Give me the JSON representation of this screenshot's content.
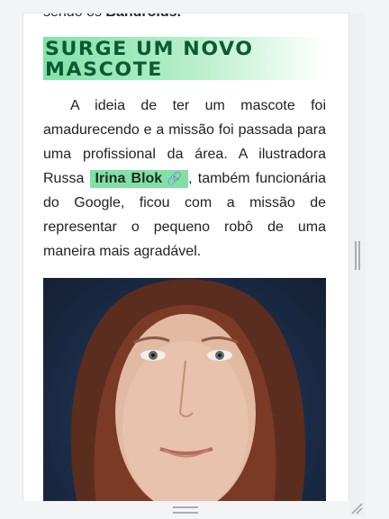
{
  "article": {
    "prev_line_text": "sendo os ",
    "prev_line_bold": "Bandroids.",
    "heading": "Surge um novo mascote",
    "paragraph": {
      "part1": "A ideia de ter um mascote foi amadurecendo e a missão foi passada para uma profissional da área. A ilustradora Russa ",
      "link_text": "Irina Blok",
      "link_icon": "link-icon",
      "part2": ", também funcionária do Google, ficou com a missão de representar o pequeno robô de uma maneira mais agradável."
    },
    "photo_alt": "Irina Blok"
  },
  "colors": {
    "heading_text": "#0c5a34",
    "heading_bg": "#82e2a8",
    "link_chip_bg": "#82e0a6",
    "photo_bg": "#1b2c47"
  }
}
